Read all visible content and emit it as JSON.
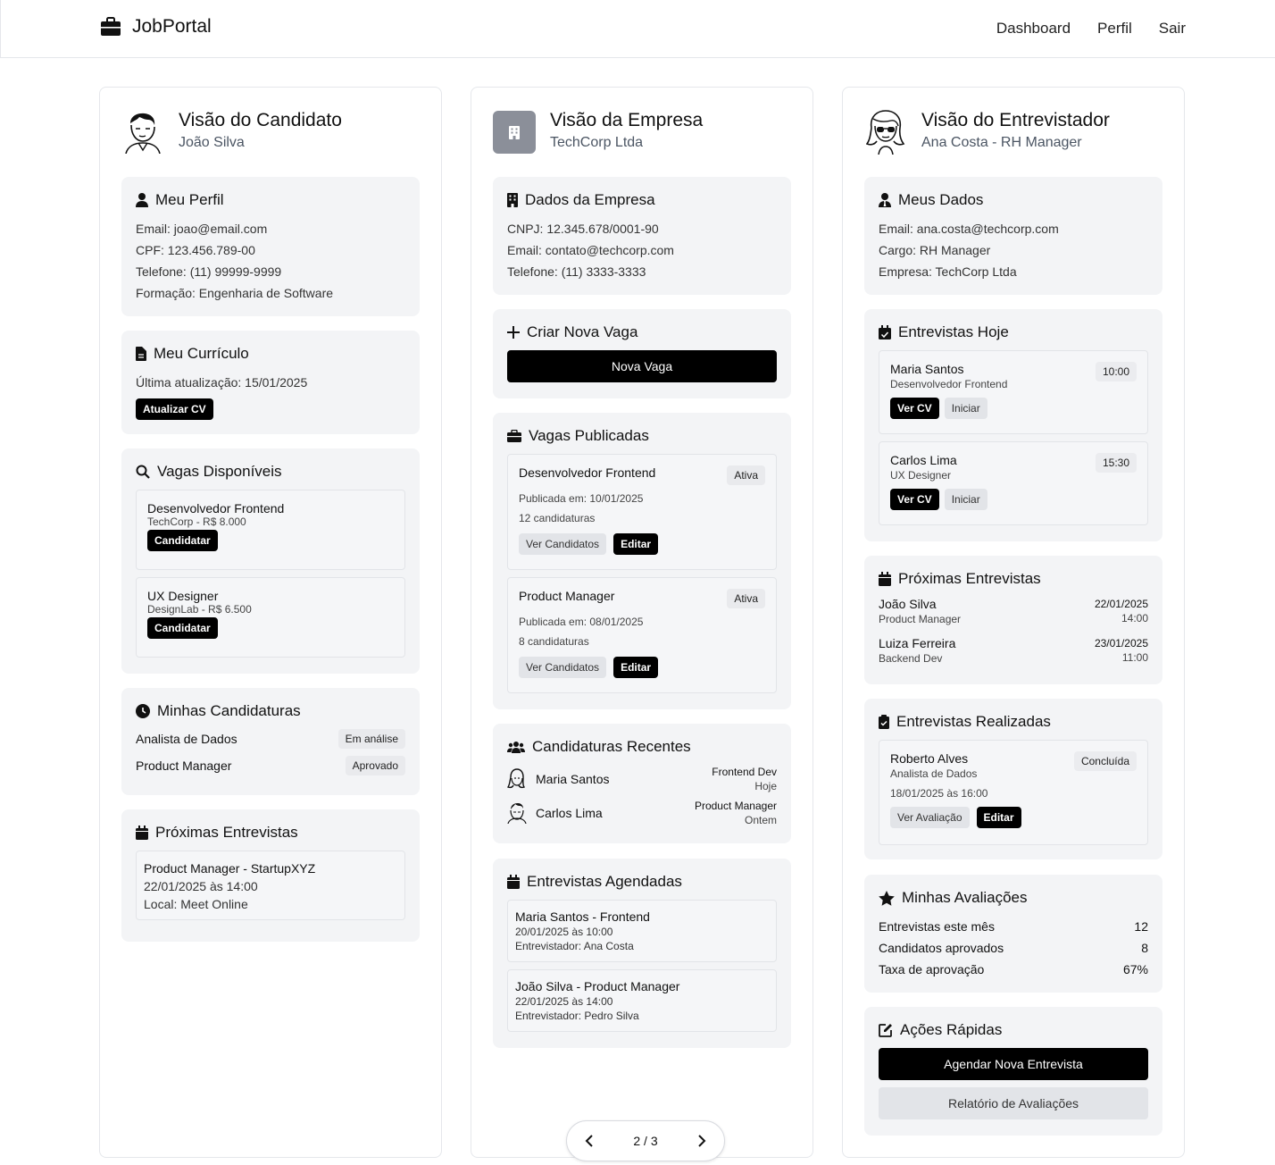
{
  "header": {
    "brand": "JobPortal",
    "nav": [
      "Dashboard",
      "Perfil",
      "Sair"
    ]
  },
  "candidate": {
    "title": "Visão do Candidato",
    "subtitle": "João Silva",
    "profile": {
      "title": "Meu Perfil",
      "lines": [
        "Email: joao@email.com",
        "CPF: 123.456.789-00",
        "Telefone: (11) 99999-9999",
        "Formação: Engenharia de Software"
      ]
    },
    "cv": {
      "title": "Meu Currículo",
      "updated": "Última atualização: 15/01/2025",
      "button": "Atualizar CV"
    },
    "jobs": {
      "title": "Vagas Disponíveis",
      "items": [
        {
          "name": "Desenvolvedor Frontend",
          "meta": "TechCorp - R$ 8.000",
          "button": "Candidatar"
        },
        {
          "name": "UX Designer",
          "meta": "DesignLab - R$ 6.500",
          "button": "Candidatar"
        }
      ]
    },
    "applications": {
      "title": "Minhas Candidaturas",
      "items": [
        {
          "name": "Analista de Dados",
          "status": "Em análise"
        },
        {
          "name": "Product Manager",
          "status": "Aprovado"
        }
      ]
    },
    "interviews": {
      "title": "Próximas Entrevistas",
      "item": {
        "l1": "Product Manager - StartupXYZ",
        "l2": "22/01/2025 às 14:00",
        "l3": "Local: Meet Online"
      }
    }
  },
  "company": {
    "title": "Visão da Empresa",
    "subtitle": "TechCorp Ltda",
    "data": {
      "title": "Dados da Empresa",
      "lines": [
        "CNPJ: 12.345.678/0001-90",
        "Email: contato@techcorp.com",
        "Telefone: (11) 3333-3333"
      ]
    },
    "create": {
      "title": "Criar Nova Vaga",
      "button": "Nova Vaga"
    },
    "published": {
      "title": "Vagas Publicadas",
      "items": [
        {
          "name": "Desenvolvedor Frontend",
          "status": "Ativa",
          "date": "Publicada em: 10/01/2025",
          "count": "12 candidaturas",
          "b1": "Ver Candidatos",
          "b2": "Editar"
        },
        {
          "name": "Product Manager",
          "status": "Ativa",
          "date": "Publicada em: 08/01/2025",
          "count": "8 candidaturas",
          "b1": "Ver Candidatos",
          "b2": "Editar"
        }
      ]
    },
    "recent": {
      "title": "Candidaturas Recentes",
      "items": [
        {
          "name": "Maria Santos",
          "role": "Frontend Dev",
          "when": "Hoje"
        },
        {
          "name": "Carlos Lima",
          "role": "Product Manager",
          "when": "Ontem"
        }
      ]
    },
    "scheduled": {
      "title": "Entrevistas Agendadas",
      "items": [
        {
          "l1": "Maria Santos - Frontend",
          "l2": "20/01/2025 às 10:00",
          "l3": "Entrevistador: Ana Costa"
        },
        {
          "l1": "João Silva - Product Manager",
          "l2": "22/01/2025 às 14:00",
          "l3": "Entrevistador: Pedro Silva"
        }
      ]
    }
  },
  "interviewer": {
    "title": "Visão do Entrevistador",
    "subtitle": "Ana Costa - RH Manager",
    "data": {
      "title": "Meus Dados",
      "lines": [
        "Email: ana.costa@techcorp.com",
        "Cargo: RH Manager",
        "Empresa: TechCorp Ltda"
      ]
    },
    "today": {
      "title": "Entrevistas Hoje",
      "items": [
        {
          "name": "Maria Santos",
          "role": "Desenvolvedor Frontend",
          "time": "10:00",
          "b1": "Ver CV",
          "b2": "Iniciar"
        },
        {
          "name": "Carlos Lima",
          "role": "UX Designer",
          "time": "15:30",
          "b1": "Ver CV",
          "b2": "Iniciar"
        }
      ]
    },
    "upcoming": {
      "title": "Próximas Entrevistas",
      "items": [
        {
          "name": "João Silva",
          "role": "Product Manager",
          "date": "22/01/2025",
          "time": "14:00"
        },
        {
          "name": "Luiza Ferreira",
          "role": "Backend Dev",
          "date": "23/01/2025",
          "time": "11:00"
        }
      ]
    },
    "done": {
      "title": "Entrevistas Realizadas",
      "item": {
        "name": "Roberto Alves",
        "role": "Analista de Dados",
        "status": "Concluída",
        "date": "18/01/2025 às 16:00",
        "b1": "Ver Avaliação",
        "b2": "Editar"
      }
    },
    "ratings": {
      "title": "Minhas Avaliações",
      "items": [
        {
          "label": "Entrevistas este mês",
          "value": "12"
        },
        {
          "label": "Candidatos aprovados",
          "value": "8"
        },
        {
          "label": "Taxa de aprovação",
          "value": "67%"
        }
      ]
    },
    "actions": {
      "title": "Ações Rápidas",
      "b1": "Agendar Nova Entrevista",
      "b2": "Relatório de Avaliações"
    }
  },
  "pager": {
    "label": "2 / 3"
  }
}
